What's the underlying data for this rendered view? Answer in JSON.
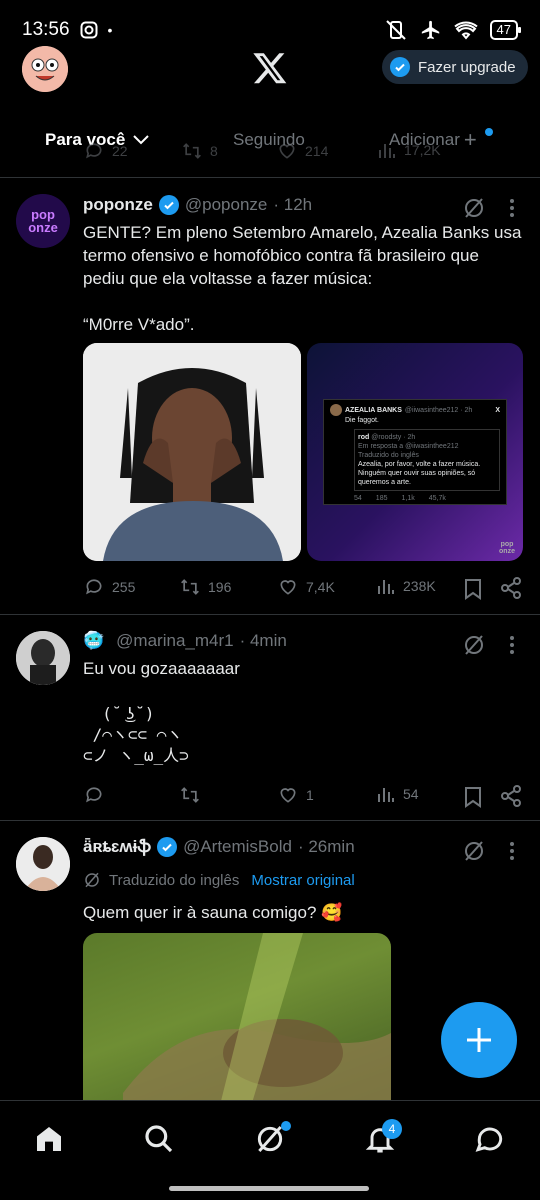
{
  "status_bar": {
    "time": "13:56",
    "battery": "47"
  },
  "header": {
    "upgrade_label": "Fazer upgrade"
  },
  "tabs": {
    "for_you": "Para você",
    "following": "Seguindo",
    "add": "Adicionar"
  },
  "prev_post_actions": {
    "replies": "22",
    "reposts": "8",
    "likes": "214",
    "views": "17,2K"
  },
  "posts": [
    {
      "name": "poponze",
      "handle": "@poponze",
      "time": "· 12h",
      "text": "GENTE? Em pleno Setembro Amarelo, Azealia Banks usa termo ofensivo e homofóbico contra fã brasileiro que pediu que ela voltasse a fazer música:\n\n“M0rre V*ado”.",
      "replies": "255",
      "reposts": "196",
      "likes": "7,4K",
      "views": "238K",
      "embed": {
        "name": "AZEALIA BANKS",
        "handle": "@iiwasinthee212 · 2h",
        "text": "Die faggot.",
        "reply_name": "rod",
        "reply_handle": "@roodsty · 2h",
        "reply_to": "Em resposta a @iiwasinthee212",
        "translated": "Traduzido do inglês",
        "reply_text": "Azealia, por favor, volte a fazer música. Ninguém quer ouvir suas opiniões, só queremos a arte.",
        "stats": [
          "54",
          "185",
          "1,1k",
          "45,7k"
        ],
        "brand": "pop onze"
      },
      "logo_text": "pop onze"
    },
    {
      "name": "",
      "handle": "@marina_m4r1",
      "time": "· 4min",
      "text": "Eu vou gozaaaaaaar",
      "ascii": "  (˘ ͜ʖ˘)\n /⌒ヽ⊂⊂ ⌒ヽ\n⊂ノ ヽ_ω_人⊃",
      "replies": "",
      "reposts": "",
      "likes": "1",
      "views": "54"
    },
    {
      "name": "ǟʀȶɛʍɨֆ",
      "handle": "@ArtemisBold",
      "time": "· 26min",
      "translated_label": "Traduzido do inglês",
      "show_original": "Mostrar original",
      "text": "Quem quer ir à sauna comigo? 🥰"
    }
  ],
  "nav": {
    "notifications_badge": "4"
  },
  "colors": {
    "accent": "#1d9bf0",
    "background": "#000000",
    "muted": "#71767b"
  }
}
